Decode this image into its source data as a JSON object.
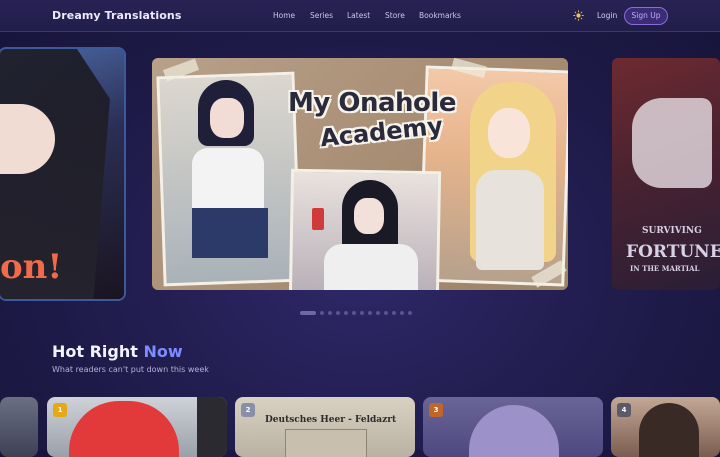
{
  "header": {
    "brand": "Dreamy Translations",
    "nav": [
      {
        "label": "Home",
        "name": "nav-home"
      },
      {
        "label": "Series",
        "name": "nav-series"
      },
      {
        "label": "Latest",
        "name": "nav-latest"
      },
      {
        "label": "Store",
        "name": "nav-store"
      },
      {
        "label": "Bookmarks",
        "name": "nav-bookmarks"
      }
    ],
    "theme_icon": "sun-icon",
    "login_label": "Login",
    "signup_label": "Sign Up"
  },
  "carousel": {
    "left_title_fragment": "on!",
    "main_title_line1": "My Onahole",
    "main_title_line2": "Academy",
    "right_title_lines": [
      "SURVIVING",
      "FORTUNE",
      "IN THE MARTIAL"
    ],
    "dot_count": 13,
    "active_dot": 0
  },
  "hot_section": {
    "title_main": "Hot Right",
    "title_accent": "Now",
    "subtitle": "What readers can't put down this week",
    "cards": [
      {
        "rank": "1",
        "badge_color": "#e6a817"
      },
      {
        "rank": "2",
        "badge_color": "#8a8fa8",
        "caption": "Deutsches Heer - Feldazrt"
      },
      {
        "rank": "3",
        "badge_color": "#c0662a"
      },
      {
        "rank": "4",
        "badge_color": "#5a5a6a"
      }
    ]
  },
  "colors": {
    "accent": "#7c8cff",
    "signup_text": "#c9a8ff",
    "background": "#1f1b4a"
  }
}
